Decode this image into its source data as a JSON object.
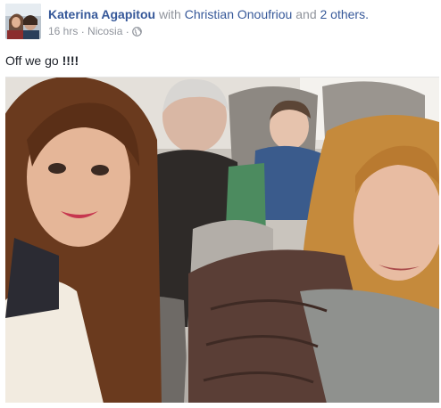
{
  "post": {
    "author": "Katerina Agapitou",
    "with_word": "with",
    "tagged_person": "Christian Onoufriou",
    "and_word": "and",
    "others": "2 others.",
    "time": "16 hrs",
    "separator": "·",
    "location": "Nicosia",
    "separator2": "·",
    "privacy_icon": "globe-icon",
    "text_main": "Off we go ",
    "text_bold": "!!!!"
  },
  "photo": {
    "icon": "group-selfie-photo"
  },
  "colors": {
    "link": "#365899",
    "meta": "#90949c",
    "text": "#1d2129"
  }
}
